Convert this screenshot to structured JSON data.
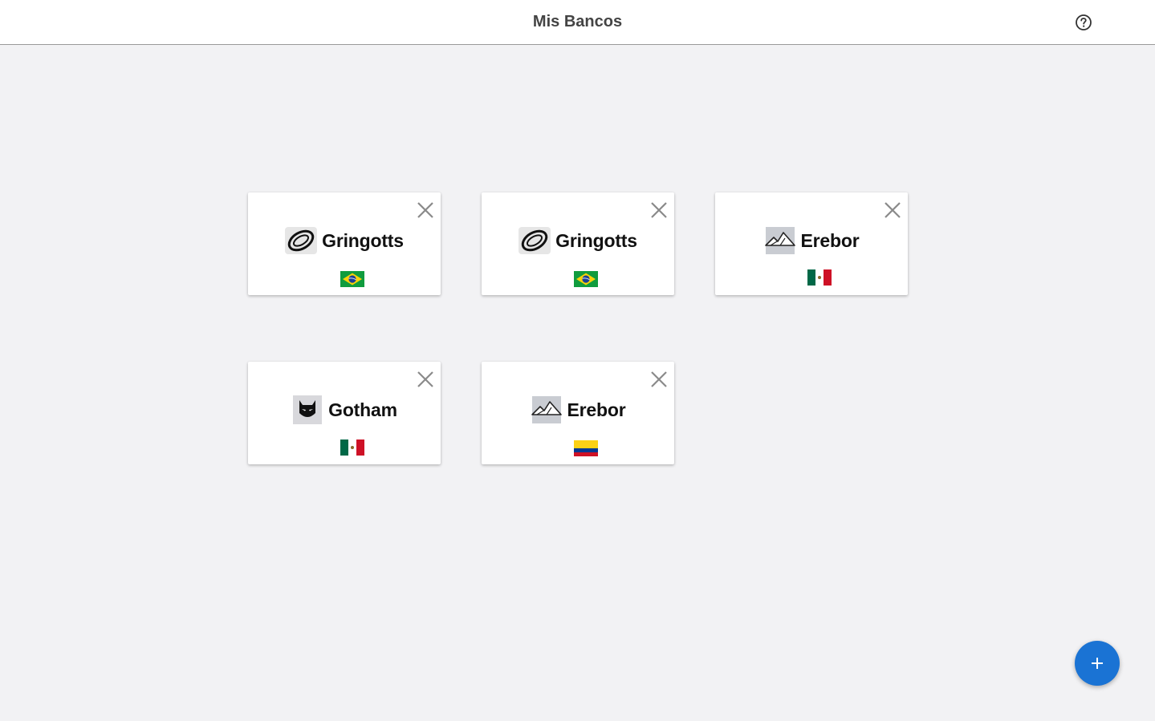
{
  "header": {
    "title": "Mis Bancos",
    "help_icon": "help-circle-icon"
  },
  "banks": [
    {
      "name": "Gringotts",
      "logo": "coin-ring-icon",
      "country": "Brazil",
      "flag": "brazil-flag-icon",
      "close_icon": "close-icon"
    },
    {
      "name": "Gringotts",
      "logo": "coin-ring-icon",
      "country": "Brazil",
      "flag": "brazil-flag-icon",
      "close_icon": "close-icon"
    },
    {
      "name": "Erebor",
      "logo": "mountain-icon",
      "country": "Mexico",
      "flag": "mexico-flag-icon",
      "close_icon": "close-icon"
    },
    {
      "name": "Gotham",
      "logo": "bat-mask-icon",
      "country": "Mexico",
      "flag": "mexico-flag-icon",
      "close_icon": "close-icon"
    },
    {
      "name": "Erebor",
      "logo": "mountain-icon",
      "country": "Colombia",
      "flag": "colombia-flag-icon",
      "close_icon": "close-icon"
    }
  ],
  "fab": {
    "icon": "plus-icon"
  },
  "colors": {
    "background": "#f2f2f4",
    "card": "#ffffff",
    "accent": "#1a73d4",
    "close": "#8a8a8a"
  }
}
